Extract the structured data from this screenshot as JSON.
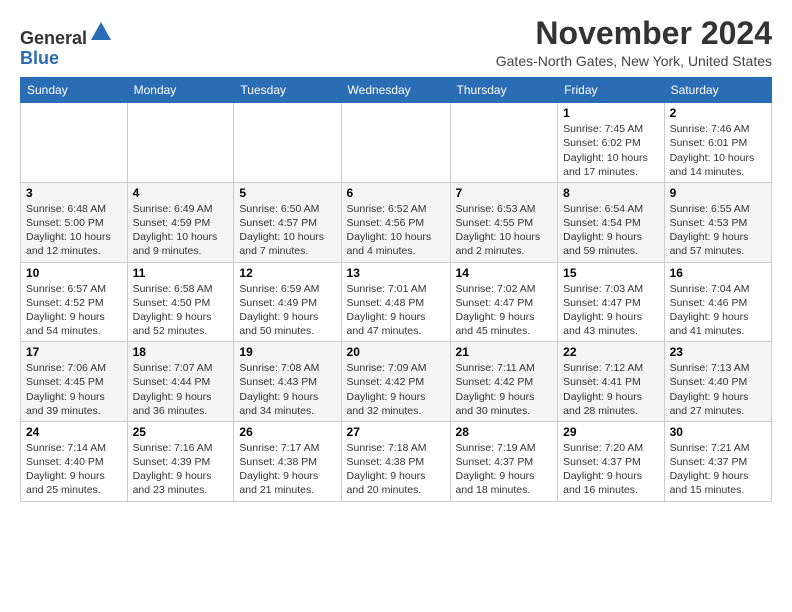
{
  "logo": {
    "general": "General",
    "blue": "Blue"
  },
  "header": {
    "title": "November 2024",
    "location": "Gates-North Gates, New York, United States"
  },
  "days_of_week": [
    "Sunday",
    "Monday",
    "Tuesday",
    "Wednesday",
    "Thursday",
    "Friday",
    "Saturday"
  ],
  "weeks": [
    [
      null,
      null,
      null,
      null,
      null,
      {
        "day": "1",
        "sunrise": "Sunrise: 7:45 AM",
        "sunset": "Sunset: 6:02 PM",
        "daylight": "Daylight: 10 hours and 17 minutes."
      },
      {
        "day": "2",
        "sunrise": "Sunrise: 7:46 AM",
        "sunset": "Sunset: 6:01 PM",
        "daylight": "Daylight: 10 hours and 14 minutes."
      }
    ],
    [
      {
        "day": "3",
        "sunrise": "Sunrise: 6:48 AM",
        "sunset": "Sunset: 5:00 PM",
        "daylight": "Daylight: 10 hours and 12 minutes."
      },
      {
        "day": "4",
        "sunrise": "Sunrise: 6:49 AM",
        "sunset": "Sunset: 4:59 PM",
        "daylight": "Daylight: 10 hours and 9 minutes."
      },
      {
        "day": "5",
        "sunrise": "Sunrise: 6:50 AM",
        "sunset": "Sunset: 4:57 PM",
        "daylight": "Daylight: 10 hours and 7 minutes."
      },
      {
        "day": "6",
        "sunrise": "Sunrise: 6:52 AM",
        "sunset": "Sunset: 4:56 PM",
        "daylight": "Daylight: 10 hours and 4 minutes."
      },
      {
        "day": "7",
        "sunrise": "Sunrise: 6:53 AM",
        "sunset": "Sunset: 4:55 PM",
        "daylight": "Daylight: 10 hours and 2 minutes."
      },
      {
        "day": "8",
        "sunrise": "Sunrise: 6:54 AM",
        "sunset": "Sunset: 4:54 PM",
        "daylight": "Daylight: 9 hours and 59 minutes."
      },
      {
        "day": "9",
        "sunrise": "Sunrise: 6:55 AM",
        "sunset": "Sunset: 4:53 PM",
        "daylight": "Daylight: 9 hours and 57 minutes."
      }
    ],
    [
      {
        "day": "10",
        "sunrise": "Sunrise: 6:57 AM",
        "sunset": "Sunset: 4:52 PM",
        "daylight": "Daylight: 9 hours and 54 minutes."
      },
      {
        "day": "11",
        "sunrise": "Sunrise: 6:58 AM",
        "sunset": "Sunset: 4:50 PM",
        "daylight": "Daylight: 9 hours and 52 minutes."
      },
      {
        "day": "12",
        "sunrise": "Sunrise: 6:59 AM",
        "sunset": "Sunset: 4:49 PM",
        "daylight": "Daylight: 9 hours and 50 minutes."
      },
      {
        "day": "13",
        "sunrise": "Sunrise: 7:01 AM",
        "sunset": "Sunset: 4:48 PM",
        "daylight": "Daylight: 9 hours and 47 minutes."
      },
      {
        "day": "14",
        "sunrise": "Sunrise: 7:02 AM",
        "sunset": "Sunset: 4:47 PM",
        "daylight": "Daylight: 9 hours and 45 minutes."
      },
      {
        "day": "15",
        "sunrise": "Sunrise: 7:03 AM",
        "sunset": "Sunset: 4:47 PM",
        "daylight": "Daylight: 9 hours and 43 minutes."
      },
      {
        "day": "16",
        "sunrise": "Sunrise: 7:04 AM",
        "sunset": "Sunset: 4:46 PM",
        "daylight": "Daylight: 9 hours and 41 minutes."
      }
    ],
    [
      {
        "day": "17",
        "sunrise": "Sunrise: 7:06 AM",
        "sunset": "Sunset: 4:45 PM",
        "daylight": "Daylight: 9 hours and 39 minutes."
      },
      {
        "day": "18",
        "sunrise": "Sunrise: 7:07 AM",
        "sunset": "Sunset: 4:44 PM",
        "daylight": "Daylight: 9 hours and 36 minutes."
      },
      {
        "day": "19",
        "sunrise": "Sunrise: 7:08 AM",
        "sunset": "Sunset: 4:43 PM",
        "daylight": "Daylight: 9 hours and 34 minutes."
      },
      {
        "day": "20",
        "sunrise": "Sunrise: 7:09 AM",
        "sunset": "Sunset: 4:42 PM",
        "daylight": "Daylight: 9 hours and 32 minutes."
      },
      {
        "day": "21",
        "sunrise": "Sunrise: 7:11 AM",
        "sunset": "Sunset: 4:42 PM",
        "daylight": "Daylight: 9 hours and 30 minutes."
      },
      {
        "day": "22",
        "sunrise": "Sunrise: 7:12 AM",
        "sunset": "Sunset: 4:41 PM",
        "daylight": "Daylight: 9 hours and 28 minutes."
      },
      {
        "day": "23",
        "sunrise": "Sunrise: 7:13 AM",
        "sunset": "Sunset: 4:40 PM",
        "daylight": "Daylight: 9 hours and 27 minutes."
      }
    ],
    [
      {
        "day": "24",
        "sunrise": "Sunrise: 7:14 AM",
        "sunset": "Sunset: 4:40 PM",
        "daylight": "Daylight: 9 hours and 25 minutes."
      },
      {
        "day": "25",
        "sunrise": "Sunrise: 7:16 AM",
        "sunset": "Sunset: 4:39 PM",
        "daylight": "Daylight: 9 hours and 23 minutes."
      },
      {
        "day": "26",
        "sunrise": "Sunrise: 7:17 AM",
        "sunset": "Sunset: 4:38 PM",
        "daylight": "Daylight: 9 hours and 21 minutes."
      },
      {
        "day": "27",
        "sunrise": "Sunrise: 7:18 AM",
        "sunset": "Sunset: 4:38 PM",
        "daylight": "Daylight: 9 hours and 20 minutes."
      },
      {
        "day": "28",
        "sunrise": "Sunrise: 7:19 AM",
        "sunset": "Sunset: 4:37 PM",
        "daylight": "Daylight: 9 hours and 18 minutes."
      },
      {
        "day": "29",
        "sunrise": "Sunrise: 7:20 AM",
        "sunset": "Sunset: 4:37 PM",
        "daylight": "Daylight: 9 hours and 16 minutes."
      },
      {
        "day": "30",
        "sunrise": "Sunrise: 7:21 AM",
        "sunset": "Sunset: 4:37 PM",
        "daylight": "Daylight: 9 hours and 15 minutes."
      }
    ]
  ]
}
